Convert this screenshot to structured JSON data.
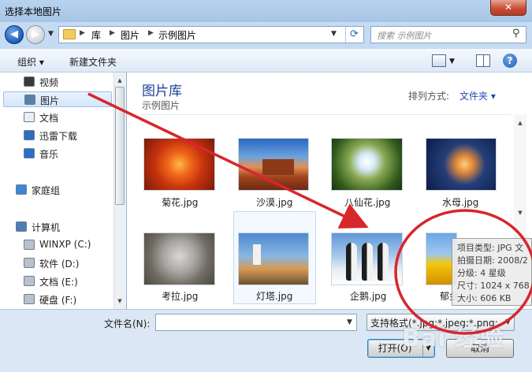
{
  "window": {
    "title": "选择本地图片",
    "close_glyph": "✕"
  },
  "address": {
    "back_glyph": "◀",
    "forward_glyph": "▶",
    "crumbs": [
      "库",
      "图片",
      "示例图片"
    ],
    "search_placeholder": "搜索 示例图片"
  },
  "toolbar": {
    "organize": "组织 ▾",
    "new_folder": "新建文件夹",
    "help_glyph": "?"
  },
  "nav": {
    "items": [
      {
        "label": "视频",
        "icon": "video-icon"
      },
      {
        "label": "图片",
        "icon": "pictures-icon",
        "selected": true
      },
      {
        "label": "文档",
        "icon": "documents-icon"
      },
      {
        "label": "迅雷下载",
        "icon": "download-icon"
      },
      {
        "label": "音乐",
        "icon": "music-icon"
      },
      {
        "label": "家庭组",
        "icon": "homegroup-icon"
      },
      {
        "label": "计算机",
        "icon": "computer-icon"
      },
      {
        "label": "WINXP (C:)",
        "icon": "drive-icon"
      },
      {
        "label": "软件 (D:)",
        "icon": "drive-icon"
      },
      {
        "label": "文档 (E:)",
        "icon": "drive-icon"
      },
      {
        "label": "硬盘 (F:)",
        "icon": "drive-icon"
      }
    ]
  },
  "library": {
    "title": "图片库",
    "subtitle": "示例图片",
    "sort_label": "排列方式:",
    "sort_value": "文件夹 ▾"
  },
  "files": [
    {
      "name": "菊花.jpg",
      "thumb": "flower"
    },
    {
      "name": "沙漠.jpg",
      "thumb": "desert"
    },
    {
      "name": "八仙花.jpg",
      "thumb": "hydrangea"
    },
    {
      "name": "水母.jpg",
      "thumb": "jellyfish"
    },
    {
      "name": "考拉.jpg",
      "thumb": "koala"
    },
    {
      "name": "灯塔.jpg",
      "thumb": "lighthouse",
      "selected": true
    },
    {
      "name": "企鹅.jpg",
      "thumb": "penguins"
    },
    {
      "name": "郁金香.jpg",
      "thumb": "tulips",
      "visible_text": "郁金"
    }
  ],
  "tooltip": {
    "lines": [
      "项目类型: JPG 文",
      "拍摄日期: 2008/2",
      "分级: 4 星级",
      "尺寸: 1024 x 768",
      "大小: 606 KB"
    ]
  },
  "footer": {
    "filename_label": "文件名(N):",
    "filename_value": "",
    "filter_value": "支持格式(*.jpg;*.jpeg;*.png;*.b",
    "open_label": "打开(O)",
    "cancel_label": "取消"
  },
  "watermark": {
    "text": "Bai 经验"
  },
  "colors": {
    "annotation": "#d8262c",
    "title_blue": "#1e3f99",
    "link_blue": "#1e4bb1"
  }
}
